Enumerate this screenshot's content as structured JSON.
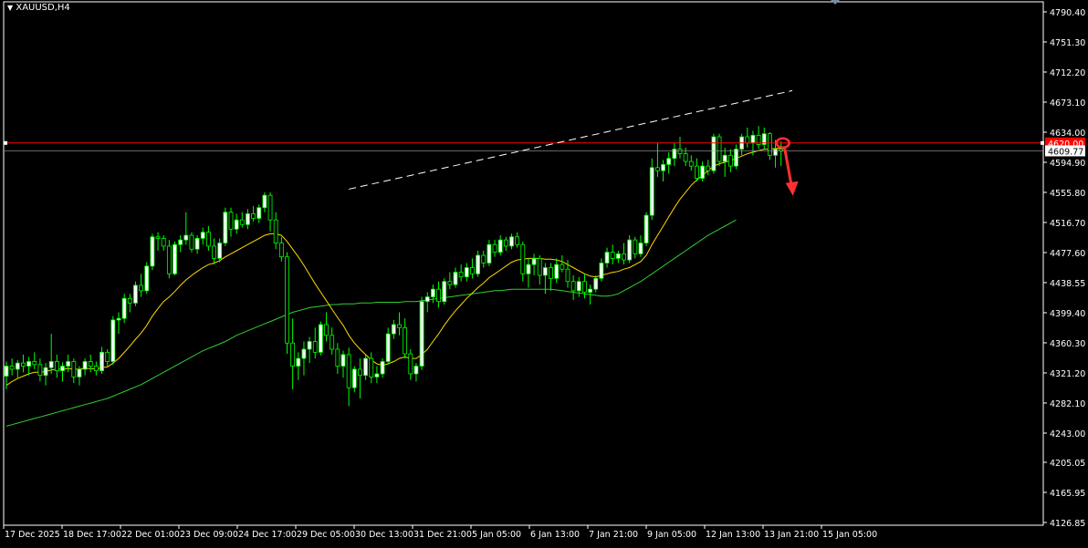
{
  "window": {
    "symbol_title": "XAUUSD,H4"
  },
  "price_axis": {
    "ticks": [
      "4790.40",
      "4751.30",
      "4712.20",
      "4673.10",
      "4634.00",
      "4594.90",
      "4555.80",
      "4516.70",
      "4477.60",
      "4438.55",
      "4399.40",
      "4360.30",
      "4321.20",
      "4282.10",
      "4243.00",
      "4205.05",
      "4165.95",
      "4126.85"
    ],
    "current_bid_label": "4609.77",
    "marked_level_label": "4620.00"
  },
  "time_axis": {
    "ticks": [
      "17 Dec 2025",
      "18 Dec 17:00",
      "22 Dec 01:00",
      "23 Dec 09:00",
      "24 Dec 17:00",
      "29 Dec 05:00",
      "30 Dec 13:00",
      "31 Dec 21:00",
      "5 Jan 05:00",
      "6 Jan 13:00",
      "7 Jan 21:00",
      "9 Jan 05:00",
      "12 Jan 13:00",
      "13 Jan 21:00",
      "15 Jan 05:00"
    ]
  },
  "colors": {
    "background": "#000000",
    "frame": "#ffffff",
    "bull_candle": "#ffffff",
    "bear_candle": "#000000",
    "wick": "#00ff00",
    "fast_ma": "#ffd700",
    "slow_ma": "#32cd32",
    "marked_line": "#ff0000",
    "bid_line": "#a0a0a0",
    "trendline": "#ffffff",
    "annotation": "#ff3030"
  },
  "annotations": {
    "down_arrow_icon": "arrow-down-icon",
    "circle_marker": "circle-marker"
  },
  "chart_data": {
    "type": "candlestick",
    "title": "XAUUSD,H4",
    "ylim": [
      4126.85,
      4810
    ],
    "y_scale": "linear",
    "grid": false,
    "legend": "none",
    "ohlc": [
      [
        4317,
        4336,
        4300,
        4330
      ],
      [
        4330,
        4340,
        4318,
        4326
      ],
      [
        4326,
        4338,
        4315,
        4334
      ],
      [
        4334,
        4345,
        4322,
        4330
      ],
      [
        4330,
        4342,
        4318,
        4336
      ],
      [
        4336,
        4348,
        4326,
        4332
      ],
      [
        4332,
        4340,
        4310,
        4318
      ],
      [
        4318,
        4334,
        4305,
        4328
      ],
      [
        4328,
        4372,
        4320,
        4336
      ],
      [
        4336,
        4345,
        4315,
        4324
      ],
      [
        4324,
        4335,
        4310,
        4330
      ],
      [
        4330,
        4345,
        4322,
        4336
      ],
      [
        4336,
        4340,
        4308,
        4316
      ],
      [
        4316,
        4330,
        4305,
        4326
      ],
      [
        4326,
        4340,
        4318,
        4336
      ],
      [
        4336,
        4345,
        4322,
        4330
      ],
      [
        4330,
        4336,
        4318,
        4324
      ],
      [
        4324,
        4355,
        4320,
        4348
      ],
      [
        4348,
        4352,
        4330,
        4336
      ],
      [
        4336,
        4395,
        4332,
        4390
      ],
      [
        4390,
        4400,
        4372,
        4392
      ],
      [
        4392,
        4424,
        4386,
        4418
      ],
      [
        4418,
        4424,
        4400,
        4412
      ],
      [
        4412,
        4440,
        4408,
        4435
      ],
      [
        4435,
        4450,
        4420,
        4428
      ],
      [
        4428,
        4465,
        4424,
        4460
      ],
      [
        4460,
        4502,
        4455,
        4498
      ],
      [
        4498,
        4504,
        4480,
        4496
      ],
      [
        4496,
        4500,
        4480,
        4486
      ],
      [
        4486,
        4494,
        4444,
        4450
      ],
      [
        4450,
        4492,
        4448,
        4488
      ],
      [
        4488,
        4500,
        4478,
        4494
      ],
      [
        4494,
        4530,
        4488,
        4500
      ],
      [
        4500,
        4504,
        4478,
        4482
      ],
      [
        4482,
        4500,
        4476,
        4496
      ],
      [
        4496,
        4510,
        4488,
        4504
      ],
      [
        4504,
        4512,
        4480,
        4486
      ],
      [
        4486,
        4496,
        4462,
        4470
      ],
      [
        4470,
        4496,
        4465,
        4490
      ],
      [
        4490,
        4536,
        4486,
        4530
      ],
      [
        4530,
        4536,
        4498,
        4508
      ],
      [
        4508,
        4528,
        4502,
        4520
      ],
      [
        4520,
        4530,
        4510,
        4514
      ],
      [
        4514,
        4534,
        4508,
        4528
      ],
      [
        4528,
        4538,
        4518,
        4522
      ],
      [
        4522,
        4540,
        4516,
        4536
      ],
      [
        4536,
        4556,
        4530,
        4552
      ],
      [
        4552,
        4556,
        4505,
        4520
      ],
      [
        4520,
        4530,
        4482,
        4490
      ],
      [
        4490,
        4498,
        4466,
        4472
      ],
      [
        4472,
        4478,
        4346,
        4360
      ],
      [
        4360,
        4392,
        4300,
        4330
      ],
      [
        4330,
        4348,
        4312,
        4340
      ],
      [
        4340,
        4362,
        4318,
        4352
      ],
      [
        4352,
        4368,
        4334,
        4362
      ],
      [
        4362,
        4380,
        4340,
        4348
      ],
      [
        4348,
        4388,
        4344,
        4384
      ],
      [
        4384,
        4400,
        4362,
        4370
      ],
      [
        4370,
        4380,
        4345,
        4352
      ],
      [
        4352,
        4360,
        4320,
        4330
      ],
      [
        4330,
        4350,
        4315,
        4345
      ],
      [
        4345,
        4354,
        4278,
        4302
      ],
      [
        4302,
        4330,
        4296,
        4326
      ],
      [
        4326,
        4340,
        4288,
        4318
      ],
      [
        4318,
        4345,
        4312,
        4340
      ],
      [
        4340,
        4348,
        4308,
        4316
      ],
      [
        4316,
        4330,
        4308,
        4320
      ],
      [
        4320,
        4340,
        4315,
        4336
      ],
      [
        4336,
        4380,
        4332,
        4372
      ],
      [
        4372,
        4390,
        4365,
        4384
      ],
      [
        4384,
        4400,
        4370,
        4380
      ],
      [
        4380,
        4392,
        4340,
        4346
      ],
      [
        4346,
        4352,
        4312,
        4320
      ],
      [
        4320,
        4334,
        4310,
        4330
      ],
      [
        4330,
        4420,
        4325,
        4414
      ],
      [
        4414,
        4426,
        4400,
        4420
      ],
      [
        4420,
        4436,
        4412,
        4430
      ],
      [
        4430,
        4440,
        4406,
        4414
      ],
      [
        4414,
        4444,
        4410,
        4440
      ],
      [
        4440,
        4452,
        4430,
        4436
      ],
      [
        4436,
        4458,
        4432,
        4452
      ],
      [
        4452,
        4462,
        4440,
        4446
      ],
      [
        4446,
        4464,
        4440,
        4458
      ],
      [
        4458,
        4470,
        4444,
        4450
      ],
      [
        4450,
        4480,
        4446,
        4474
      ],
      [
        4474,
        4480,
        4458,
        4464
      ],
      [
        4464,
        4494,
        4460,
        4488
      ],
      [
        4488,
        4494,
        4472,
        4478
      ],
      [
        4478,
        4500,
        4474,
        4494
      ],
      [
        4494,
        4498,
        4480,
        4486
      ],
      [
        4486,
        4502,
        4482,
        4498
      ],
      [
        4498,
        4504,
        4484,
        4488
      ],
      [
        4488,
        4492,
        4440,
        4450
      ],
      [
        4450,
        4470,
        4432,
        4462
      ],
      [
        4462,
        4476,
        4448,
        4470
      ],
      [
        4470,
        4474,
        4436,
        4448
      ],
      [
        4448,
        4464,
        4424,
        4458
      ],
      [
        4458,
        4464,
        4428,
        4444
      ],
      [
        4444,
        4470,
        4438,
        4462
      ],
      [
        4462,
        4474,
        4452,
        4456
      ],
      [
        4456,
        4468,
        4432,
        4440
      ],
      [
        4440,
        4448,
        4416,
        4428
      ],
      [
        4428,
        4446,
        4420,
        4440
      ],
      [
        4440,
        4450,
        4418,
        4426
      ],
      [
        4426,
        4436,
        4410,
        4430
      ],
      [
        4430,
        4448,
        4426,
        4444
      ],
      [
        4444,
        4470,
        4440,
        4464
      ],
      [
        4464,
        4484,
        4458,
        4478
      ],
      [
        4478,
        4488,
        4462,
        4470
      ],
      [
        4470,
        4480,
        4464,
        4476
      ],
      [
        4476,
        4490,
        4462,
        4468
      ],
      [
        4468,
        4500,
        4464,
        4494
      ],
      [
        4494,
        4498,
        4470,
        4476
      ],
      [
        4476,
        4500,
        4472,
        4490
      ],
      [
        4490,
        4530,
        4486,
        4526
      ],
      [
        4526,
        4600,
        4520,
        4588
      ],
      [
        4588,
        4620,
        4576,
        4584
      ],
      [
        4584,
        4598,
        4570,
        4592
      ],
      [
        4592,
        4608,
        4580,
        4600
      ],
      [
        4600,
        4620,
        4590,
        4612
      ],
      [
        4612,
        4628,
        4600,
        4606
      ],
      [
        4606,
        4614,
        4590,
        4596
      ],
      [
        4596,
        4604,
        4584,
        4590
      ],
      [
        4590,
        4600,
        4570,
        4574
      ],
      [
        4574,
        4596,
        4570,
        4590
      ],
      [
        4590,
        4598,
        4578,
        4584
      ],
      [
        4584,
        4632,
        4580,
        4628
      ],
      [
        4628,
        4632,
        4590,
        4596
      ],
      [
        4596,
        4614,
        4576,
        4604
      ],
      [
        4604,
        4612,
        4582,
        4590
      ],
      [
        4590,
        4618,
        4586,
        4612
      ],
      [
        4612,
        4632,
        4604,
        4628
      ],
      [
        4628,
        4640,
        4614,
        4620
      ],
      [
        4620,
        4636,
        4604,
        4630
      ],
      [
        4630,
        4642,
        4612,
        4618
      ],
      [
        4618,
        4640,
        4612,
        4632
      ],
      [
        4632,
        4634,
        4598,
        4604
      ],
      [
        4604,
        4624,
        4588,
        4612
      ],
      [
        4612,
        4622,
        4590,
        4609.77
      ]
    ],
    "fast_ma": [
      4305,
      4310,
      4314,
      4317,
      4320,
      4322,
      4322,
      4323,
      4325,
      4326,
      4326,
      4327,
      4326,
      4326,
      4327,
      4327,
      4326,
      4328,
      4329,
      4334,
      4340,
      4348,
      4356,
      4365,
      4373,
      4383,
      4395,
      4405,
      4414,
      4420,
      4427,
      4435,
      4442,
      4448,
      4453,
      4458,
      4462,
      4464,
      4467,
      4472,
      4476,
      4480,
      4484,
      4488,
      4492,
      4496,
      4500,
      4502,
      4502,
      4500,
      4492,
      4482,
      4472,
      4461,
      4449,
      4437,
      4426,
      4415,
      4404,
      4393,
      4383,
      4370,
      4360,
      4352,
      4345,
      4338,
      4333,
      4331,
      4333,
      4336,
      4340,
      4342,
      4340,
      4340,
      4345,
      4352,
      4362,
      4372,
      4383,
      4393,
      4402,
      4410,
      4418,
      4425,
      4432,
      4438,
      4445,
      4450,
      4455,
      4460,
      4465,
      4468,
      4469,
      4470,
      4470,
      4470,
      4469,
      4469,
      4468,
      4466,
      4462,
      4458,
      4454,
      4450,
      4447,
      4446,
      4448,
      4450,
      4452,
      4453,
      4456,
      4458,
      4462,
      4466,
      4474,
      4488,
      4500,
      4512,
      4524,
      4536,
      4547,
      4556,
      4565,
      4572,
      4578,
      4584,
      4590,
      4593,
      4595,
      4597,
      4600,
      4603,
      4606,
      4608,
      4610,
      4612,
      4612,
      4613,
      4613
    ],
    "slow_ma": [
      4252,
      4254,
      4256,
      4258,
      4260,
      4262,
      4264,
      4266,
      4268,
      4270,
      4272,
      4274,
      4276,
      4278,
      4280,
      4282,
      4284,
      4286,
      4288,
      4291,
      4294,
      4297,
      4300,
      4303,
      4306,
      4310,
      4314,
      4318,
      4322,
      4326,
      4330,
      4334,
      4338,
      4342,
      4346,
      4350,
      4353,
      4356,
      4359,
      4362,
      4366,
      4370,
      4373,
      4376,
      4379,
      4382,
      4385,
      4388,
      4391,
      4394,
      4397,
      4400,
      4402,
      4404,
      4406,
      4407,
      4408,
      4409,
      4410,
      4410,
      4411,
      4411,
      4411,
      4412,
      4412,
      4412,
      4413,
      4413,
      4413,
      4413,
      4413,
      4414,
      4414,
      4414,
      4415,
      4416,
      4417,
      4418,
      4419,
      4420,
      4421,
      4422,
      4423,
      4424,
      4425,
      4426,
      4427,
      4428,
      4428,
      4429,
      4430,
      4430,
      4430,
      4430,
      4430,
      4430,
      4430,
      4430,
      4429,
      4428,
      4427,
      4426,
      4425,
      4424,
      4423,
      4422,
      4421,
      4421,
      4422,
      4424,
      4428,
      4432,
      4436,
      4440,
      4445,
      4450,
      4455,
      4460,
      4465,
      4470,
      4475,
      4480,
      4485,
      4490,
      4495,
      4500,
      4504,
      4508,
      4512,
      4516,
      4520
    ],
    "horizontal_levels": [
      {
        "value": 4620.0,
        "style": "solid"
      },
      {
        "value": 4609.77,
        "style": "bid"
      }
    ],
    "trendline": {
      "from": {
        "bar": 61,
        "price": 4560
      },
      "to": {
        "bar": 140,
        "price": 4688
      },
      "style": "dashed"
    }
  }
}
